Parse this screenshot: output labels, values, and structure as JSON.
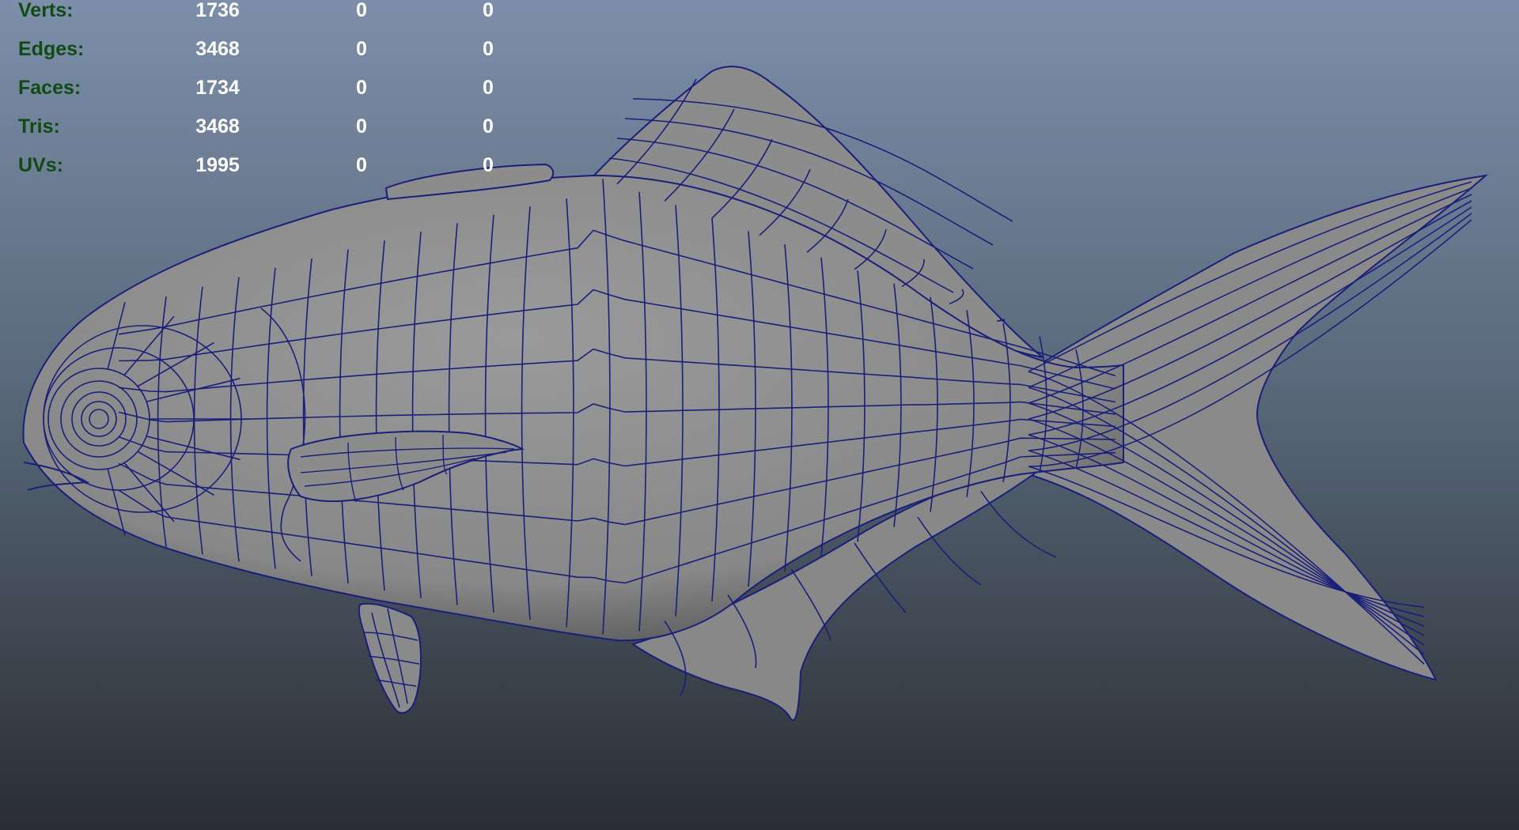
{
  "viewport": {
    "background_top": "#7c8ea9",
    "background_bottom": "#2a2e33",
    "mesh_fill": "#8a8a8a",
    "wire_color": "#1a1f7a"
  },
  "heads_up_display": {
    "label_color": "#104c12",
    "value_color": "#ffffff",
    "rows": [
      {
        "label": "Verts:",
        "values": [
          "1736",
          "0",
          "0"
        ]
      },
      {
        "label": "Edges:",
        "values": [
          "3468",
          "0",
          "0"
        ]
      },
      {
        "label": "Faces:",
        "values": [
          "1734",
          "0",
          "0"
        ]
      },
      {
        "label": "Tris:",
        "values": [
          "3468",
          "0",
          "0"
        ]
      },
      {
        "label": "UVs:",
        "values": [
          "1995",
          "0",
          "0"
        ]
      }
    ]
  },
  "scene": {
    "object": "fish-mesh",
    "display_mode": "wireframe-on-shaded"
  }
}
